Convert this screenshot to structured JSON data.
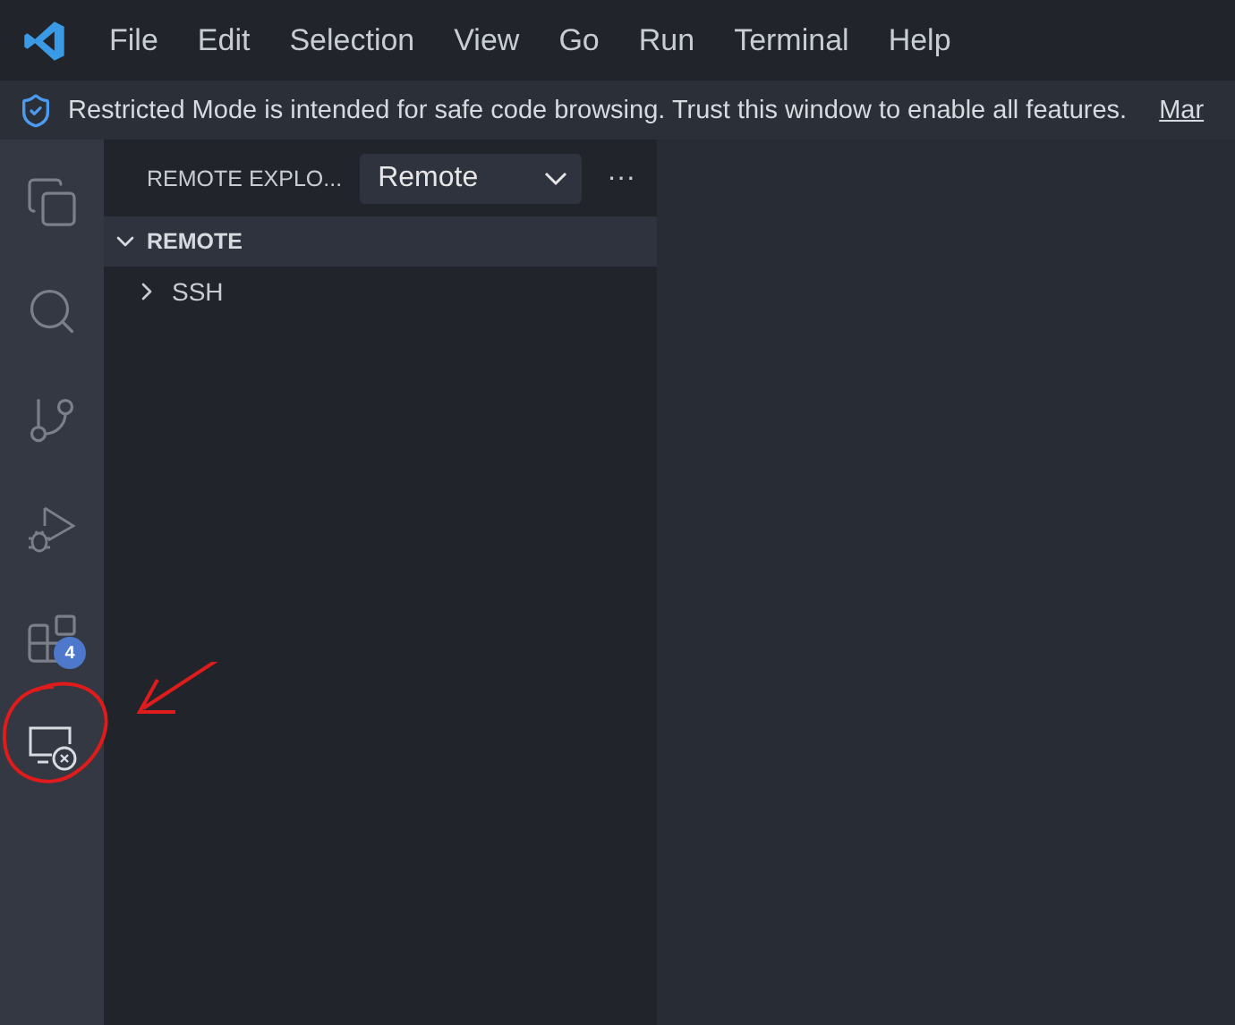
{
  "menu_bar": {
    "items": [
      "File",
      "Edit",
      "Selection",
      "View",
      "Go",
      "Run",
      "Terminal",
      "Help"
    ]
  },
  "banner": {
    "message": "Restricted Mode is intended for safe code browsing. Trust this window to enable all features.",
    "link": "Mar"
  },
  "activity_bar": [
    {
      "kind": "files",
      "selected": false
    },
    {
      "kind": "search",
      "selected": false
    },
    {
      "kind": "source-control",
      "selected": false
    },
    {
      "kind": "run-debug",
      "selected": false
    },
    {
      "kind": "extensions",
      "selected": false,
      "badge": "4"
    },
    {
      "kind": "remote",
      "selected": true
    }
  ],
  "sidebar": {
    "title": "REMOTE EXPLO...",
    "dropdown": {
      "value": "Remote"
    },
    "more": "···",
    "section": {
      "title": "REMOTE",
      "expanded": true,
      "items": [
        {
          "label": "SSH",
          "expanded": false
        }
      ]
    }
  }
}
